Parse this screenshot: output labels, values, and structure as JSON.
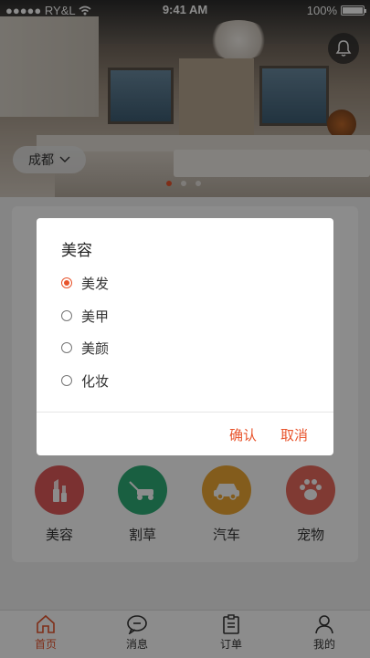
{
  "status_bar": {
    "carrier": "●●●●● RY&L",
    "time": "9:41 AM",
    "battery": "100%"
  },
  "banner": {
    "city": "成都",
    "carousel_pages": 3,
    "active_page": 1
  },
  "categories": [
    {
      "label": "美容",
      "color": "#e0595a",
      "icon": "lipstick-icon"
    },
    {
      "label": "割草",
      "color": "#2fae77",
      "icon": "lawn-mower-icon"
    },
    {
      "label": "汽车",
      "color": "#eea833",
      "icon": "car-icon"
    },
    {
      "label": "宠物",
      "color": "#e96a5d",
      "icon": "paw-icon"
    }
  ],
  "dialog": {
    "title": "美容",
    "options": [
      "美发",
      "美甲",
      "美颜",
      "化妆"
    ],
    "selected_index": 0,
    "confirm_label": "确认",
    "cancel_label": "取消"
  },
  "tabbar": {
    "items": [
      {
        "label": "首页",
        "icon": "home-icon"
      },
      {
        "label": "消息",
        "icon": "message-icon"
      },
      {
        "label": "订单",
        "icon": "clipboard-icon"
      },
      {
        "label": "我的",
        "icon": "user-icon"
      }
    ],
    "active_index": 0
  },
  "colors": {
    "accent": "#e8542c",
    "overlay": "rgba(0,0,0,0.45)"
  }
}
